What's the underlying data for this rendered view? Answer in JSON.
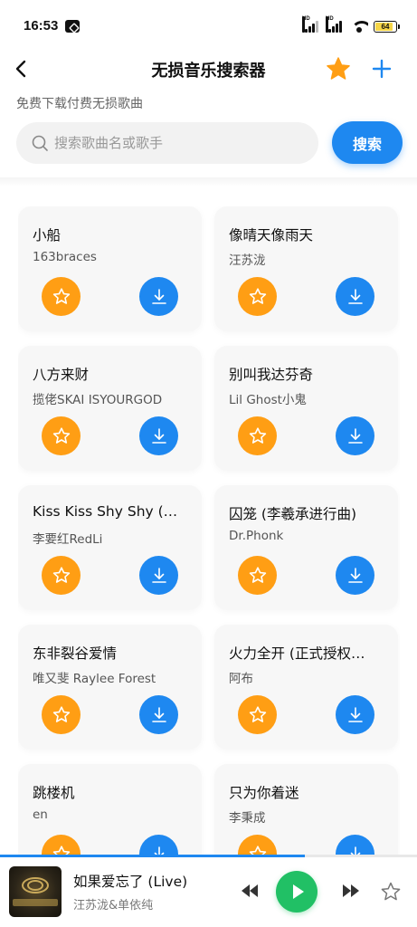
{
  "status_bar": {
    "time": "16:53",
    "battery": "64",
    "signal_1_label": "HD",
    "signal_2_label": "HD"
  },
  "header": {
    "title": "无损音乐搜索器",
    "subtitle": "免费下载付费无损歌曲"
  },
  "search": {
    "placeholder": "搜索歌曲名或歌手",
    "value": "",
    "button_label": "搜索"
  },
  "songs": [
    {
      "title": "小船",
      "artist": "163braces"
    },
    {
      "title": "像晴天像雨天",
      "artist": "汪苏泷"
    },
    {
      "title": "八方来财",
      "artist": "揽佬SKAI ISYOURGOD"
    },
    {
      "title": "别叫我达芬奇",
      "artist": "Lil Ghost小鬼"
    },
    {
      "title": "Kiss Kiss Shy Shy (…",
      "artist": "李要红RedLi"
    },
    {
      "title": "囚笼 (李羲承进行曲)",
      "artist": "Dr.Phonk"
    },
    {
      "title": "东非裂谷爱情",
      "artist": "唯又斐 Raylee Forest"
    },
    {
      "title": "火力全开 (正式授权…",
      "artist": "阿布"
    },
    {
      "title": "跳楼机",
      "artist": "en"
    },
    {
      "title": "只为你着迷",
      "artist": "李秉成"
    }
  ],
  "player": {
    "title": "如果爱忘了 (Live)",
    "artist": "汪苏泷&单依纯",
    "progress_percent": 73
  },
  "colors": {
    "accent_blue": "#1e88f0",
    "favorite_orange": "#ff9e14",
    "play_green": "#21c065"
  }
}
